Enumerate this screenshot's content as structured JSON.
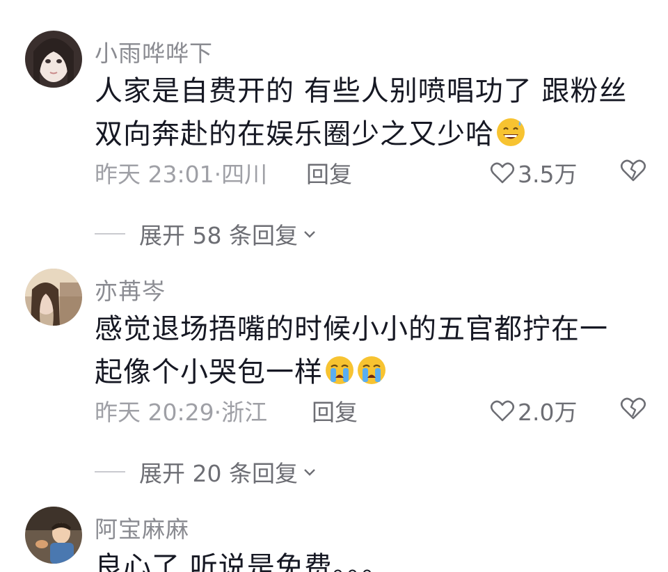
{
  "comments": [
    {
      "nickname": "小雨哗哗下",
      "text_line1": "人家是自费开的 有些人别喷唱功了 跟粉丝",
      "text_line2": "双向奔赴的在娱乐圈少之又少哈",
      "emoji": "grinning-sweat-icon",
      "time_location": "昨天 23:01·四川",
      "reply_label": "回复",
      "likes": "3.5万",
      "expand_label": "展开 58 条回复"
    },
    {
      "nickname": "亦苒岑",
      "text_line1": "感觉退场捂嘴的时候小小的五官都拧在一",
      "text_line2": "起像个小哭包一样",
      "emoji": "crying-icon",
      "time_location": "昨天 20:29·浙江",
      "reply_label": "回复",
      "likes": "2.0万",
      "expand_label": "展开 20 条回复"
    },
    {
      "nickname": "阿宝麻麻",
      "text_line1": "良心了 听说是免费。。。"
    }
  ],
  "colors": {
    "text_primary": "#161823",
    "nickname": "#8a8b91",
    "meta": "#9fa0a6",
    "action": "#6d6e74",
    "emoji_face": "#f7c331"
  }
}
